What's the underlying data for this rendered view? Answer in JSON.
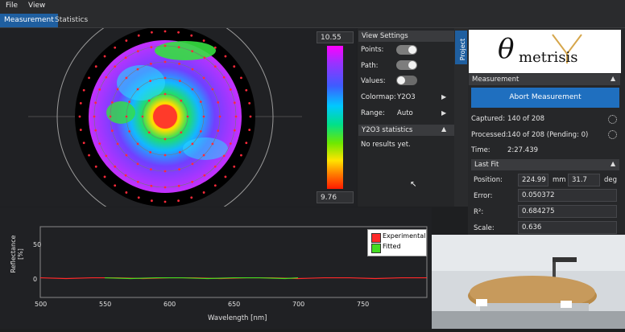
{
  "menu": {
    "file": "File",
    "view": "View"
  },
  "tabs": {
    "measurement": "Measurement",
    "statistics": "Statistics"
  },
  "scale": {
    "max": "10.55",
    "min": "9.76"
  },
  "view_settings": {
    "header": "View Settings",
    "points_label": "Points:",
    "path_label": "Path:",
    "values_label": "Values:",
    "colormap_label": "Colormap:",
    "colormap_value": "Y2O3",
    "range_label": "Range:",
    "range_value": "Auto",
    "points_on": true,
    "path_on": true,
    "values_on": false
  },
  "stats": {
    "header": "Y2O3 statistics",
    "text": "No results yet."
  },
  "project_tab": "Project",
  "logo": {
    "theta": "θ",
    "word": "metrisis"
  },
  "measurement": {
    "header": "Measurement",
    "abort_button": "Abort Measurement",
    "captured_label": "Captured:",
    "captured_value": "140 of 208",
    "processed_label": "Processed:",
    "processed_value": "140 of 208 (Pending: 0)",
    "time_label": "Time:",
    "time_value": "2:27.439"
  },
  "last_fit": {
    "header": "Last Fit",
    "position_label": "Position:",
    "position_value": "224.99",
    "position_unit": "mm",
    "angle_value": "31.7",
    "angle_unit": "deg",
    "error_label": "Error:",
    "error_value": "0.050372",
    "r2_label": "R²:",
    "r2_value": "0.684275",
    "scale_label": "Scale:",
    "scale_value": "0.636"
  },
  "chart_data": {
    "type": "line",
    "xlabel": "Wavelength [nm]",
    "ylabel": "Reflectance [%]",
    "xlim": [
      500,
      800
    ],
    "ylim": [
      -15,
      75
    ],
    "xticks": [
      500,
      550,
      600,
      650,
      700,
      750
    ],
    "yticks": [
      0,
      50
    ],
    "legend": [
      "Experimental",
      "Fitted"
    ],
    "legend_position": "top-right",
    "series": [
      {
        "name": "Experimental",
        "color": "#ff2a2a",
        "x": [
          500,
          520,
          540,
          560,
          580,
          600,
          620,
          640,
          660,
          680,
          700,
          720,
          740,
          760,
          780,
          800
        ],
        "values": [
          10,
          9,
          10,
          10,
          9,
          10,
          10,
          9,
          10,
          10,
          9,
          10,
          10,
          9,
          10,
          10
        ]
      },
      {
        "name": "Fitted",
        "color": "#44dd22",
        "x": [
          550,
          570,
          590,
          610,
          630,
          650,
          670,
          690,
          700
        ],
        "values": [
          10,
          9,
          10,
          10,
          9,
          10,
          10,
          9,
          10
        ]
      }
    ]
  },
  "colors": {
    "accent": "#1f6fbf",
    "panel": "#262729"
  }
}
